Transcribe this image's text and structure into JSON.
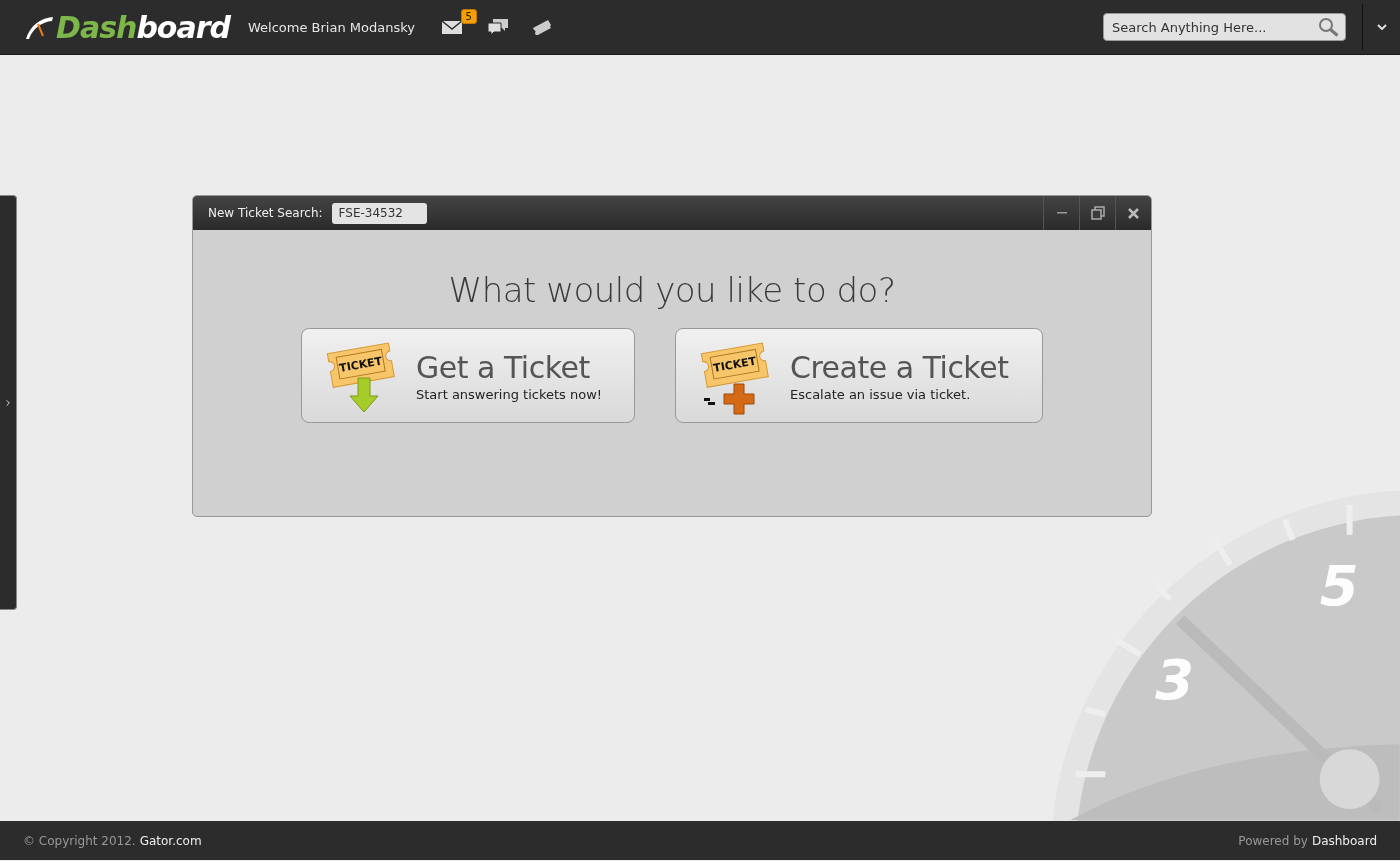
{
  "header": {
    "logo_a": "Dash",
    "logo_b": "board",
    "welcome": "Welcome Brian Modansky",
    "mail_badge": "5",
    "search": {
      "placeholder": "Search Anything Here..."
    }
  },
  "dialog": {
    "label": "New Ticket Search:",
    "value": "FSE-34532",
    "heading": "What would you like to do?",
    "actions": [
      {
        "kind": "get",
        "title": "Get a Ticket",
        "subtitle": "Start answering tickets now!",
        "icon_text": "TICKET"
      },
      {
        "kind": "create",
        "title": "Create a Ticket",
        "subtitle": "Escalate an issue via ticket.",
        "icon_text": "TICKET"
      }
    ]
  },
  "gauge": {
    "labels": [
      "3",
      "5"
    ]
  },
  "footer": {
    "copyright": "© Copyright 2012.",
    "site": "Gator.com",
    "powered": "Powered by",
    "brand": "Dashboard"
  }
}
